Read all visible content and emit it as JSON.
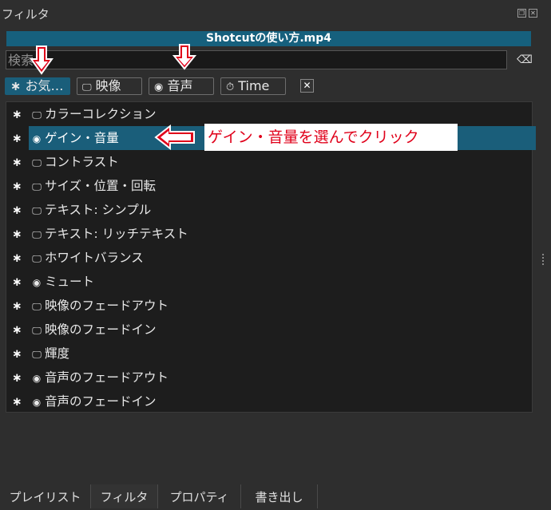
{
  "panel": {
    "title": "フィルタ",
    "clip_name": "Shotcutの使い方.mp4"
  },
  "search": {
    "placeholder": "検索"
  },
  "chips": [
    {
      "label": "お気…",
      "icon": "star-icon",
      "active": true
    },
    {
      "label": "映像",
      "icon": "monitor-icon"
    },
    {
      "label": "音声",
      "icon": "audio-icon"
    },
    {
      "label": "Time",
      "icon": "stopwatch-icon"
    }
  ],
  "filters": [
    {
      "label": "カラーコレクション",
      "icon": "monitor-icon"
    },
    {
      "label": "ゲイン・音量",
      "icon": "audio-icon",
      "selected": true
    },
    {
      "label": "コントラスト",
      "icon": "monitor-icon"
    },
    {
      "label": "サイズ・位置・回転",
      "icon": "monitor-icon"
    },
    {
      "label": "テキスト: シンプル",
      "icon": "monitor-icon"
    },
    {
      "label": "テキスト: リッチテキスト",
      "icon": "monitor-icon"
    },
    {
      "label": "ホワイトバランス",
      "icon": "monitor-icon"
    },
    {
      "label": "ミュート",
      "icon": "audio-icon"
    },
    {
      "label": "映像のフェードアウト",
      "icon": "monitor-icon"
    },
    {
      "label": "映像のフェードイン",
      "icon": "monitor-icon"
    },
    {
      "label": "輝度",
      "icon": "monitor-icon"
    },
    {
      "label": "音声のフェードアウト",
      "icon": "audio-icon"
    },
    {
      "label": "音声のフェードイン",
      "icon": "audio-icon"
    }
  ],
  "annotation": {
    "text": "ゲイン・音量を選んでクリック",
    "arrow_color": "#e0001a"
  },
  "bottom_tabs": [
    "プレイリスト",
    "フィルタ",
    "プロパティ",
    "書き出し"
  ],
  "colors": {
    "accent": "#1a5e7a",
    "background": "#2e2e2e",
    "list_background": "#1d1d1d"
  }
}
